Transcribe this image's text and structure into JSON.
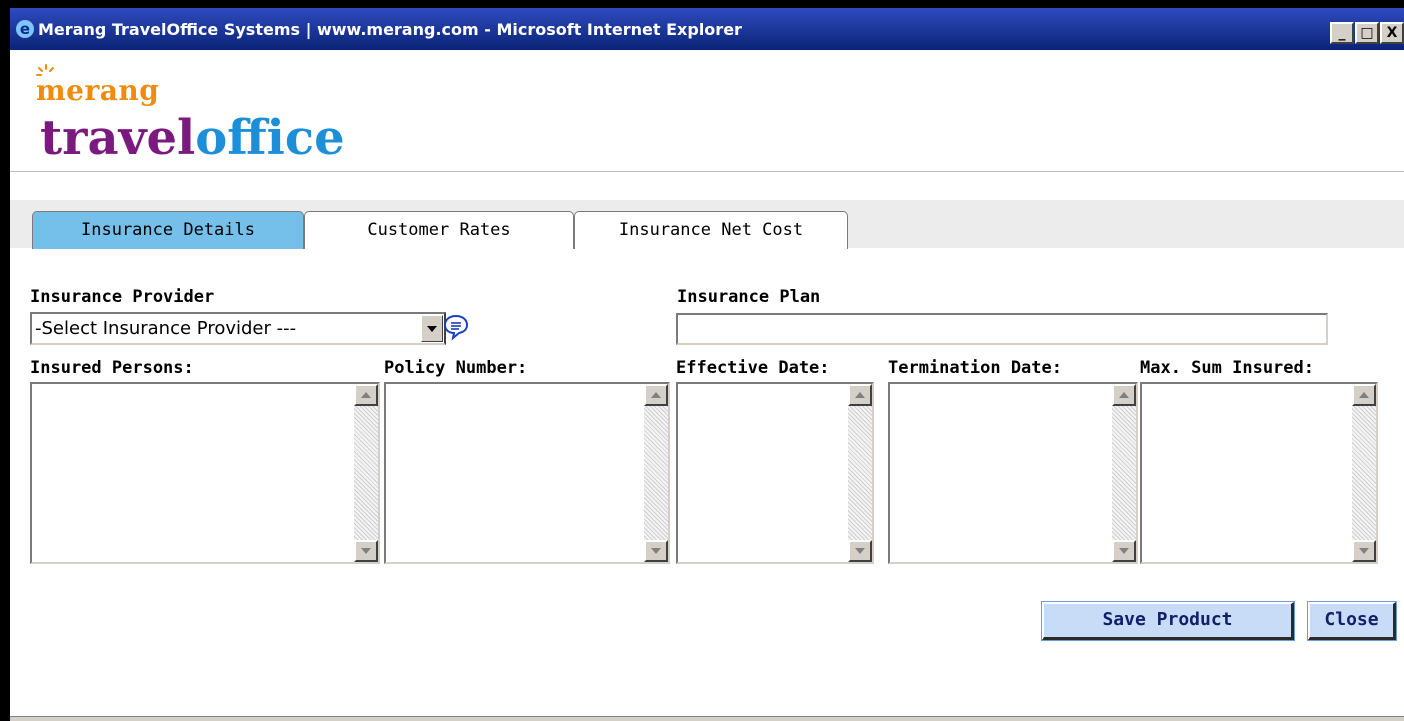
{
  "window": {
    "title": "Merang TravelOffice Systems | www.merang.com - Microsoft Internet Explorer",
    "ie_icon": "e",
    "min_glyph": "_",
    "max_glyph": "□",
    "close_glyph": "X"
  },
  "logo": {
    "line1": "merang",
    "line2a": "travel",
    "line2b": "office"
  },
  "tabs": [
    {
      "label": "Insurance Details",
      "active": true
    },
    {
      "label": "Customer Rates",
      "active": false
    },
    {
      "label": "Insurance Net Cost",
      "active": false
    }
  ],
  "form": {
    "provider_label": "Insurance Provider",
    "provider_value": "-Select Insurance Provider ---",
    "plan_label": "Insurance Plan",
    "plan_value": "",
    "columns": [
      {
        "label": "Insured Persons:",
        "value": ""
      },
      {
        "label": "Policy Number:",
        "value": ""
      },
      {
        "label": "Effective Date:",
        "value": ""
      },
      {
        "label": "Termination Date:",
        "value": ""
      },
      {
        "label": "Max. Sum Insured:",
        "value": ""
      }
    ]
  },
  "buttons": {
    "save": "Save Product",
    "close": "Close"
  },
  "icons": {
    "window": "ie-icon",
    "help": "speech-bubble-icon",
    "logo_sun": "sun-icon"
  },
  "colors": {
    "title_bar": "#1e3a9a",
    "active_tab": "#74c0ea",
    "logo_orange": "#ef8b0e",
    "logo_purple": "#7b1a7e",
    "logo_blue": "#1c8fd8",
    "button_bg": "#c8dcf7",
    "button_text": "#10216a"
  }
}
